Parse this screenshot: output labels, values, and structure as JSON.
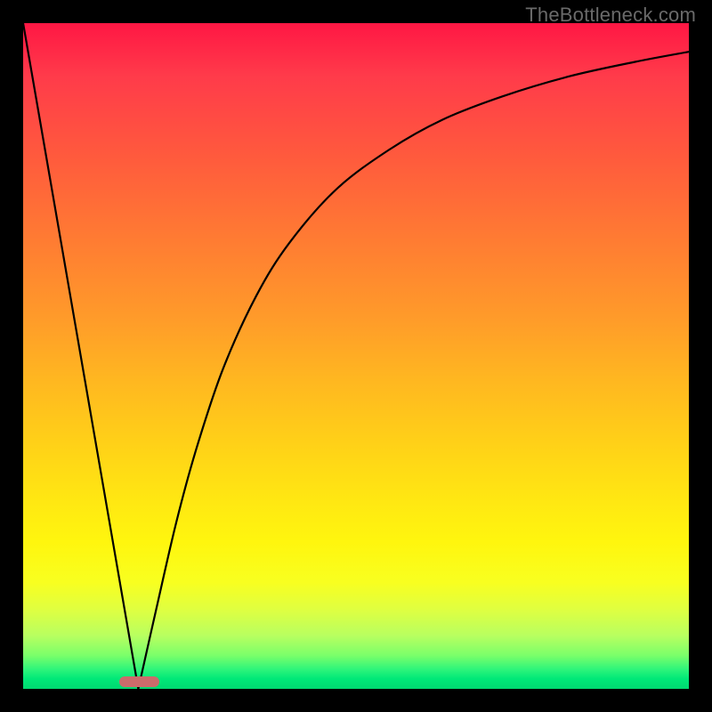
{
  "watermark": "TheBottleneck.com",
  "chart_data": {
    "type": "line",
    "title": "",
    "xlabel": "",
    "ylabel": "",
    "xlim": [
      0,
      100
    ],
    "ylim": [
      0,
      100
    ],
    "grid": false,
    "legend": false,
    "marker": {
      "x_start": 14.5,
      "x_end": 20.5,
      "y": 0,
      "color": "#cc6b6b"
    },
    "series": [
      {
        "name": "left-line",
        "type": "line",
        "x": [
          0,
          17.3
        ],
        "y": [
          100,
          0
        ]
      },
      {
        "name": "right-curve",
        "type": "line",
        "x": [
          17.3,
          20,
          23,
          26,
          30,
          35,
          40,
          47,
          55,
          63,
          72,
          82,
          92,
          100
        ],
        "y": [
          0,
          12,
          25,
          36,
          48,
          59,
          67,
          75,
          81,
          85.5,
          89,
          92,
          94.2,
          95.7
        ]
      }
    ],
    "background_gradient": {
      "direction": "vertical_top_to_bottom",
      "stops": [
        {
          "pos": 0.0,
          "color": "#ff1744"
        },
        {
          "pos": 0.2,
          "color": "#ff5a3d"
        },
        {
          "pos": 0.44,
          "color": "#ff9a2a"
        },
        {
          "pos": 0.64,
          "color": "#ffd317"
        },
        {
          "pos": 0.78,
          "color": "#fff60e"
        },
        {
          "pos": 0.92,
          "color": "#b8ff60"
        },
        {
          "pos": 1.0,
          "color": "#00d870"
        }
      ]
    }
  }
}
